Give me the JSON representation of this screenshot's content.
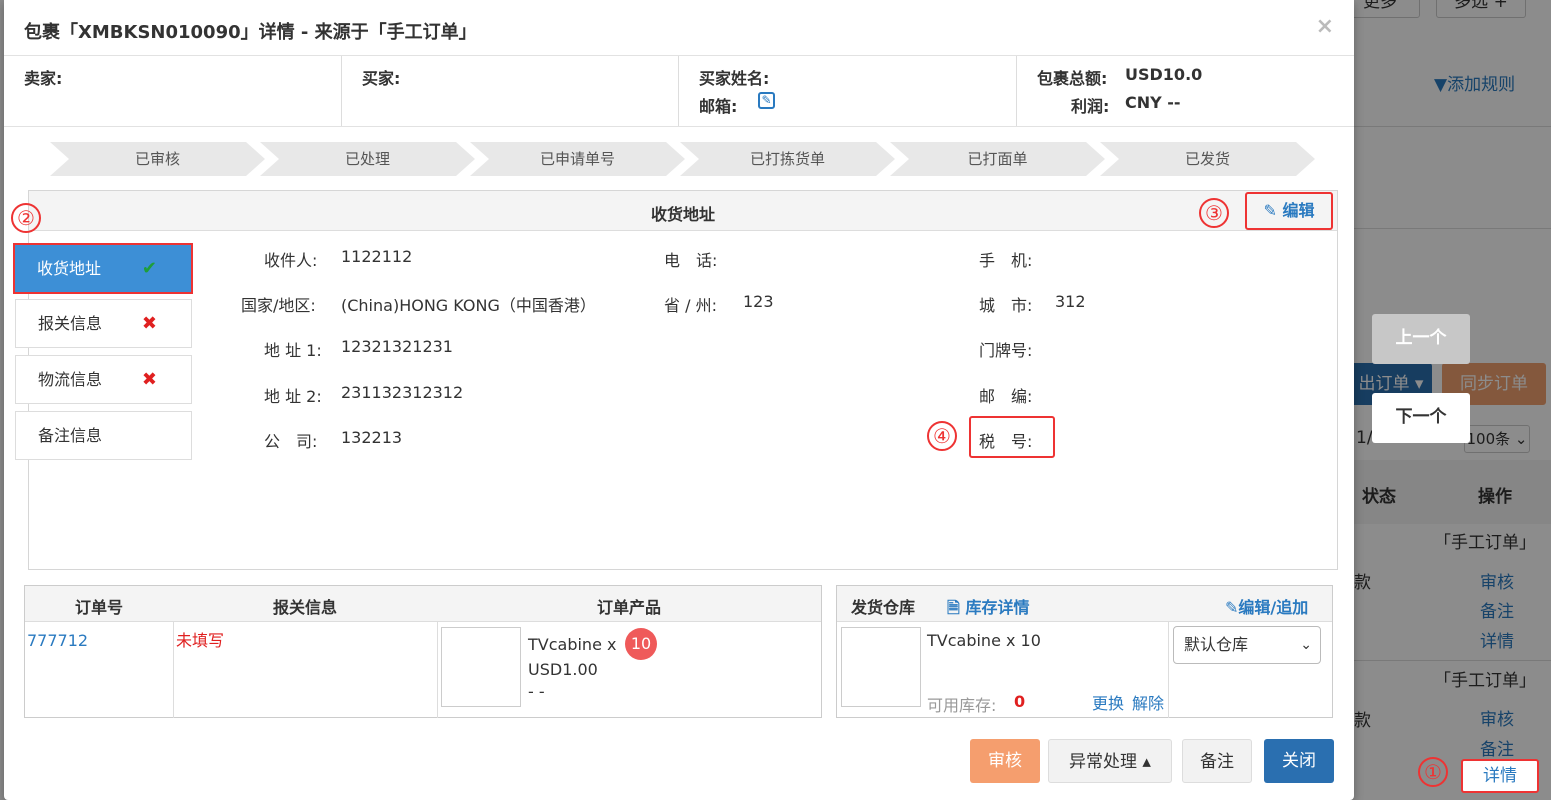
{
  "background": {
    "top_labels": [
      "更多",
      "多选 +"
    ],
    "add_rule": "添加规则",
    "prev_btn": "上一个",
    "next_btn": "下一个",
    "export_btn": "出订单 ▾",
    "sync_btn": "同步订单",
    "pager_page": "1/",
    "pager_size": "100条",
    "col_status": "状态",
    "col_ops": "操作",
    "row1_source": "「手工订单」",
    "row1_status": "款",
    "row1_ops": [
      "审核",
      "备注",
      "详情"
    ],
    "row2_source": "「手工订单」",
    "row2_status": "款",
    "row2_ops": [
      "审核",
      "备注",
      "详情"
    ]
  },
  "modal": {
    "title": "包裹「XMBKSN010090」详情 - 来源于「手工订单」",
    "close": "×",
    "seller_label": "卖家:",
    "buyer_label": "买家:",
    "buyer_name_label": "买家姓名:",
    "email_label": "邮箱:",
    "total_label": "包裹总额:",
    "total_value": "USD10.0",
    "profit_label": "利润:",
    "profit_value": "CNY --"
  },
  "steps": [
    "已审核",
    "已处理",
    "已申请单号",
    "已打拣货单",
    "已打面单",
    "已发货"
  ],
  "address": {
    "title": "收货地址",
    "edit_label": "编辑",
    "tabs": [
      {
        "label": "收货地址",
        "mark": "✔"
      },
      {
        "label": "报关信息",
        "mark": "✖"
      },
      {
        "label": "物流信息",
        "mark": "✖"
      },
      {
        "label": "备注信息",
        "mark": ""
      }
    ],
    "fields": {
      "recipient_label": "收件人:",
      "recipient": "1122112",
      "phone_label": "电　话:",
      "phone": "",
      "mobile_label": "手　机:",
      "mobile": "",
      "country_label": "国家/地区:",
      "country": "(China)HONG KONG（中国香港）",
      "province_label": "省 / 州:",
      "province": "123",
      "city_label": "城　市:",
      "city": "312",
      "addr1_label": "地 址 1:",
      "addr1": "12321321231",
      "door_label": "门牌号:",
      "door": "",
      "addr2_label": "地 址 2:",
      "addr2": "231132312312",
      "zip_label": "邮　编:",
      "zip": "",
      "company_label": "公　司:",
      "company": "132213",
      "tax_label": "税　号:",
      "tax": ""
    }
  },
  "annotations": [
    "①",
    "②",
    "③",
    "④"
  ],
  "orders": {
    "headers": [
      "订单号",
      "报关信息",
      "订单产品"
    ],
    "order_no": "777712",
    "customs": "未填写",
    "product_name": "TVcabine x",
    "product_qty": "10",
    "product_price": "USD1.00",
    "product_extra": "- -"
  },
  "warehouse": {
    "header": "发货仓库",
    "stock_link": "库存详情",
    "edit_link": "编辑/追加",
    "item": "TVcabine x 10",
    "stock_label": "可用库存:",
    "stock_value": "0",
    "replace": "更换",
    "release": "解除",
    "selected": "默认仓库"
  },
  "footer": {
    "approve": "审核",
    "exception": "异常处理 ▴",
    "note": "备注",
    "close": "关闭"
  },
  "colors": {
    "primary": "#3d8fd6",
    "approve": "#f59e6e",
    "annotation": "#e33333"
  }
}
